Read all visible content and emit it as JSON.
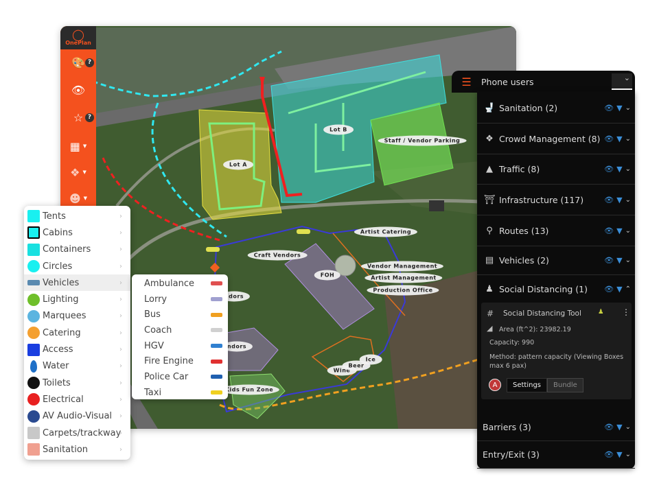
{
  "brand": {
    "name": "OnePlan",
    "color": "#f4511e"
  },
  "rail": {
    "items": [
      {
        "icon": "palette-icon",
        "help": "?"
      },
      {
        "icon": "eye-icon"
      },
      {
        "icon": "star-icon",
        "help": "?"
      },
      {
        "icon": "hatch-area-icon"
      },
      {
        "icon": "crowd-icon"
      },
      {
        "icon": "group-icon"
      }
    ]
  },
  "map_labels": {
    "lot_a": "Lot A",
    "lot_b": "Lot B",
    "staff_parking": "Staff / Vendor Parking",
    "artist_catering": "Artist Catering",
    "craft_vendors": "Craft Vendors",
    "foh": "FOH",
    "vendor_mgmt": "Vendor Management",
    "artist_mgmt": "Artist Management",
    "production_office": "Production Office",
    "vendors1": "ndors",
    "vendors2": "ndors",
    "kids_zone": "Kids Fun Zone",
    "wine": "Wine",
    "beer": "Beer",
    "ice": "Ice"
  },
  "menu": {
    "items": [
      {
        "label": "Tents",
        "icon": "tent-icon",
        "color": "#19f0f0"
      },
      {
        "label": "Cabins",
        "icon": "cabin-icon",
        "color": "#19f0f0"
      },
      {
        "label": "Containers",
        "icon": "container-icon",
        "color": "#19e0e0"
      },
      {
        "label": "Circles",
        "icon": "circle-icon",
        "color": "#19f0f0"
      },
      {
        "label": "Vehicles",
        "icon": "vehicle-icon",
        "color": "#5a8ab0"
      },
      {
        "label": "Lighting",
        "icon": "lighting-icon",
        "color": "#6fbf2a"
      },
      {
        "label": "Marquees",
        "icon": "marquee-icon",
        "color": "#5bb4e0"
      },
      {
        "label": "Catering",
        "icon": "catering-icon",
        "color": "#f4a030"
      },
      {
        "label": "Access",
        "icon": "access-icon",
        "color": "#1a3ee0"
      },
      {
        "label": "Water",
        "icon": "water-icon",
        "color": "#1e70c8"
      },
      {
        "label": "Toilets",
        "icon": "toilet-icon",
        "color": "#111111"
      },
      {
        "label": "Electrical",
        "icon": "electrical-icon",
        "color": "#e82020"
      },
      {
        "label": "AV Audio-Visual",
        "icon": "av-icon",
        "color": "#2a4a90"
      },
      {
        "label": "Carpets/trackway",
        "icon": "carpet-icon",
        "color": "#c8c8c8"
      },
      {
        "label": "Sanitation",
        "icon": "sanitation-icon",
        "color": "#f0a090"
      }
    ],
    "active": "Vehicles"
  },
  "submenu": {
    "items": [
      {
        "label": "Ambulance",
        "color": "#e05050"
      },
      {
        "label": "Lorry",
        "color": "#a0a0d0"
      },
      {
        "label": "Bus",
        "color": "#f0a020"
      },
      {
        "label": "Coach",
        "color": "#d0d0d0"
      },
      {
        "label": "HGV",
        "color": "#3080d0"
      },
      {
        "label": "Fire Engine",
        "color": "#e03030"
      },
      {
        "label": "Police Car",
        "color": "#2060b0"
      },
      {
        "label": "Taxi",
        "color": "#f0d020"
      }
    ]
  },
  "panel": {
    "title": "Phone users",
    "rows": [
      {
        "label": "Sanitation (2)",
        "icon": "toilet-icon"
      },
      {
        "label": "Crowd Management (8)",
        "icon": "crowd-icon"
      },
      {
        "label": "Traffic (8)",
        "icon": "traffic-cone-icon"
      },
      {
        "label": "Infrastructure (117)",
        "icon": "infrastructure-icon"
      },
      {
        "label": "Routes (13)",
        "icon": "route-icon"
      },
      {
        "label": "Vehicles (2)",
        "icon": "vehicle-icon"
      },
      {
        "label": "Social Distancing (1)",
        "icon": "person-icon"
      },
      {
        "label": "Barriers (3)"
      },
      {
        "label": "Entry/Exit (3)"
      }
    ],
    "card": {
      "hash": "#",
      "title": "Social Distancing Tool",
      "area": "Area (ft^2): 23982.19",
      "capacity": "Capacity: 990",
      "method": "Method: pattern capacity (Viewing Boxes max 6 pax)",
      "avatar": "A",
      "settings": "Settings",
      "bundle": "Bundle"
    },
    "accent": "#3b8fd9"
  }
}
